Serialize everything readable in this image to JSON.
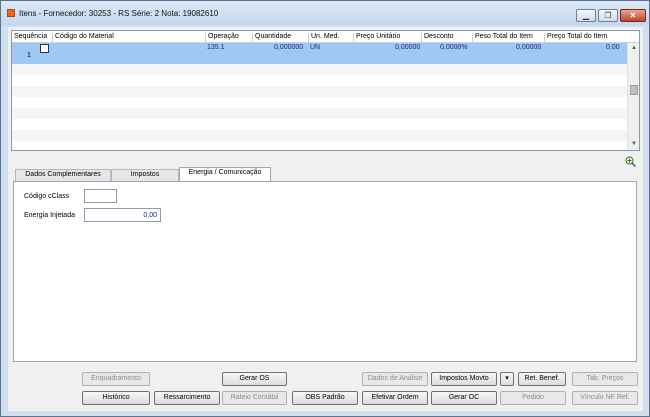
{
  "window": {
    "title": "Itens - Fornecedor: 30253 - RS Série: 2    Nota: 19082610",
    "buttons": {
      "minimize": "▁",
      "maximize": "❐",
      "close": "✕"
    }
  },
  "grid": {
    "columns": [
      "Sequência",
      "Código do Material",
      "Operação",
      "Quantidade",
      "Un. Med.",
      "Preço Unitário",
      "Desconto",
      "Peso Total do Item",
      "Preço Total do Item"
    ],
    "rows": [
      {
        "sequencia": "1",
        "codigo": "",
        "operacao": "135.1",
        "quantidade": "0,000000",
        "un_med": "UN",
        "preco_unitario": "0,00000",
        "desconto": "0,0000%",
        "peso_total": "0,00000",
        "preco_total": "0,00"
      }
    ]
  },
  "tabs": [
    {
      "label": "Dados Complementares"
    },
    {
      "label": "Impostos"
    },
    {
      "label": "Energia / Comunicação"
    }
  ],
  "form": {
    "cclass_label": "Código cClass",
    "cclass_value": "",
    "energia_label": "Energia Injetada",
    "energia_value": "0,00"
  },
  "buttons": {
    "row1": {
      "enquadramento": "Enquadramento",
      "gerar_os": "Gerar OS",
      "dados_analise": "Dados de Análise",
      "impostos_movto": "Impostos Movto",
      "dropdown": "▾",
      "ret_benef": "Ret. Benef.",
      "tab_precos": "Tab. Preços"
    },
    "row2": {
      "historico": "Histórico",
      "ressarcimento": "Ressarcimento",
      "rateio_contabil": "Rateio Contábil",
      "obs_padrao": "OBS Padrão",
      "efetivar_ordem": "Efetivar Ordem",
      "gerar_oc": "Gerar OC",
      "pedido": "Pedido",
      "vinculo_nf": "Vínculo NF Ref."
    }
  }
}
